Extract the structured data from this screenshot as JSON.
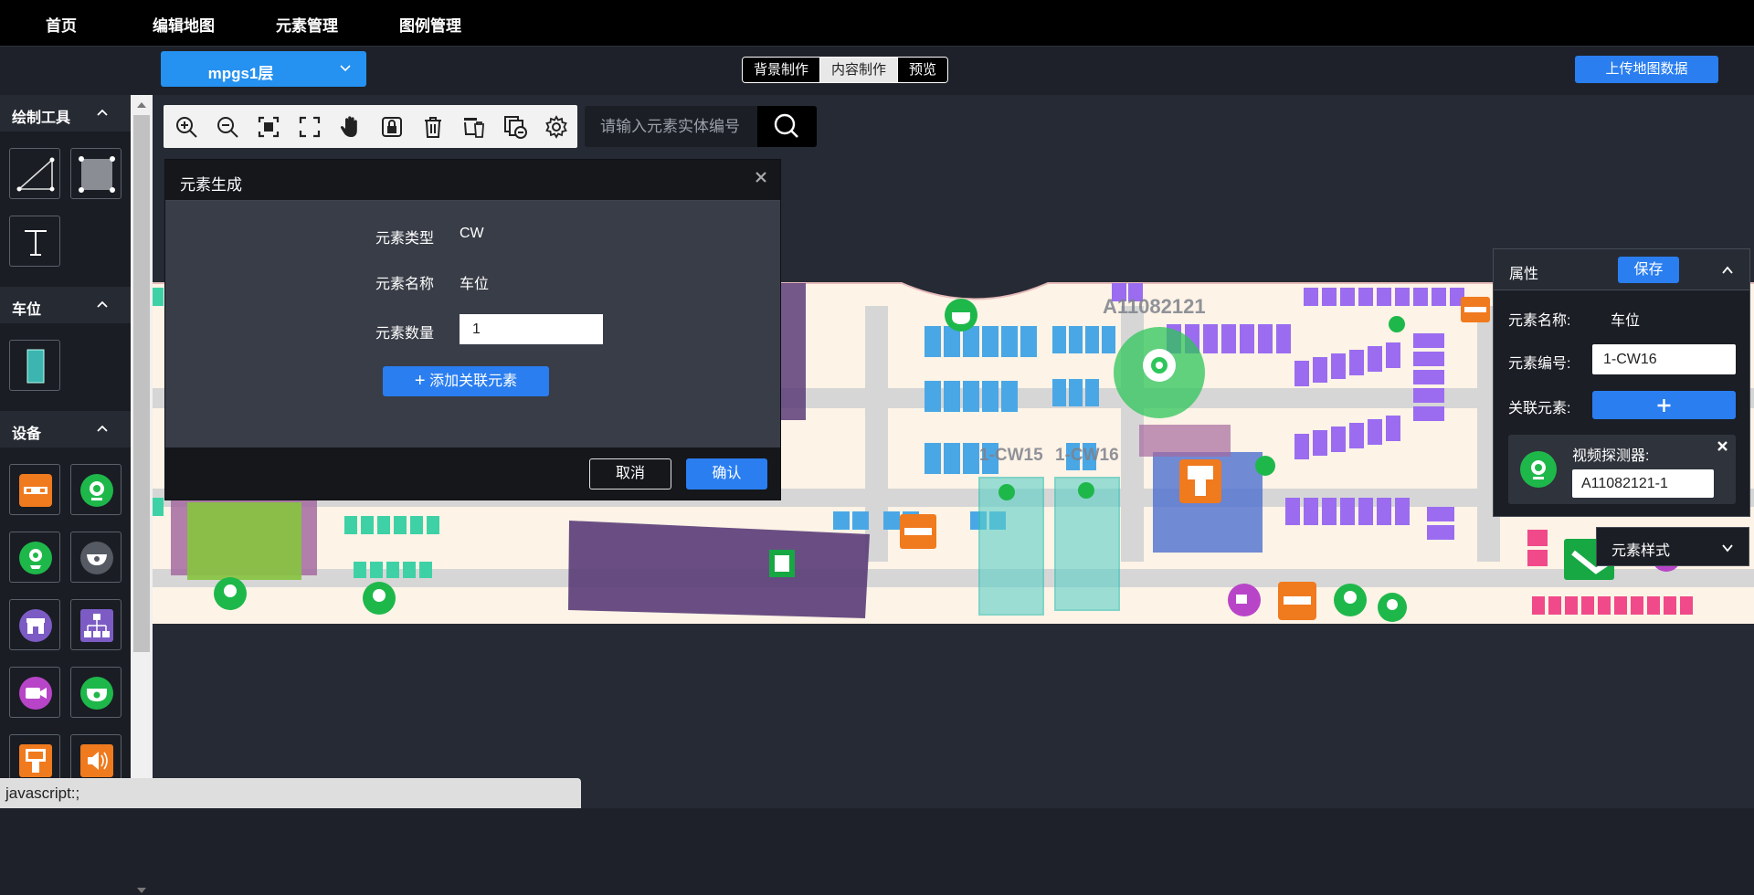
{
  "nav": {
    "items": [
      "首页",
      "编辑地图",
      "元素管理",
      "图例管理"
    ]
  },
  "toolbar": {
    "floor": "mpgs1层",
    "modes": [
      "背景制作",
      "内容制作",
      "预览"
    ],
    "active_mode": "内容制作",
    "upload_label": "上传地图数据"
  },
  "left_panel": {
    "sections": [
      {
        "title": "绘制工具",
        "tools": [
          "polyline-tool",
          "rectangle-tool",
          "text-tool"
        ]
      },
      {
        "title": "车位",
        "tools": [
          "parking-space-tool"
        ]
      },
      {
        "title": "设备",
        "tools": [
          "barrier-gate",
          "video-detector",
          "camera-detector",
          "dome-camera",
          "store-device",
          "network-device",
          "camera",
          "video-guide",
          "parking-terminal",
          "speaker"
        ]
      }
    ]
  },
  "search": {
    "placeholder": "请输入元素实体编号"
  },
  "dialog": {
    "title": "元素生成",
    "type_label": "元素类型",
    "type_value": "CW",
    "name_label": "元素名称",
    "name_value": "车位",
    "qty_label": "元素数量",
    "qty_value": "1",
    "add_related_label": "添加关联元素",
    "cancel_label": "取消",
    "confirm_label": "确认"
  },
  "properties": {
    "title": "属性",
    "save_label": "保存",
    "name_label": "元素名称:",
    "name_value": "车位",
    "code_label": "元素编号:",
    "code_value": "1-CW16",
    "related_label": "关联元素:",
    "related_card": {
      "name": "视频探测器:",
      "value": "A11082121-1"
    },
    "style_label": "元素样式"
  },
  "map": {
    "labels": {
      "zone": "A11082121",
      "cw15": "1-CW15",
      "cw16": "1-CW16"
    }
  },
  "status_text": "javascript:;",
  "colors": {
    "accent": "#2a7ef0",
    "floor_select": "#2591f0",
    "nav_bg": "#000000"
  }
}
